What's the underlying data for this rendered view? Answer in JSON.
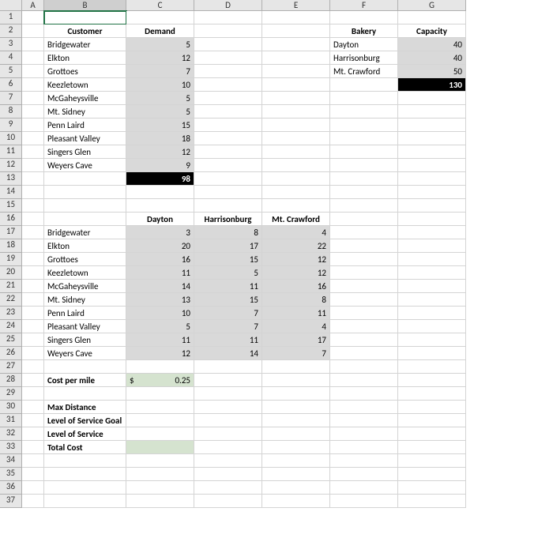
{
  "columns": [
    "",
    "A",
    "B",
    "C",
    "D",
    "E",
    "F",
    "G"
  ],
  "row_numbers": [
    1,
    2,
    3,
    4,
    5,
    6,
    7,
    8,
    9,
    10,
    11,
    12,
    13,
    14,
    15,
    16,
    17,
    18,
    19,
    20,
    21,
    22,
    23,
    24,
    25,
    26,
    27,
    28,
    29,
    30,
    31,
    32,
    33,
    34,
    35,
    36,
    37
  ],
  "headers": {
    "customer": "Customer",
    "demand": "Demand",
    "bakery": "Bakery",
    "capacity": "Capacity"
  },
  "customers": [
    {
      "name": "Bridgewater",
      "demand": 5
    },
    {
      "name": "Elkton",
      "demand": 12
    },
    {
      "name": "Grottoes",
      "demand": 7
    },
    {
      "name": "Keezletown",
      "demand": 10
    },
    {
      "name": "McGaheysville",
      "demand": 5
    },
    {
      "name": "Mt. Sidney",
      "demand": 5
    },
    {
      "name": "Penn Laird",
      "demand": 15
    },
    {
      "name": "Pleasant Valley",
      "demand": 18
    },
    {
      "name": "Singers Glen",
      "demand": 12
    },
    {
      "name": "Weyers Cave",
      "demand": 9
    }
  ],
  "demand_total": 98,
  "bakeries": [
    {
      "name": "Dayton",
      "capacity": 40
    },
    {
      "name": "Harrisonburg",
      "capacity": 40
    },
    {
      "name": "Mt. Crawford",
      "capacity": 50
    }
  ],
  "capacity_total": 130,
  "distance_cols": [
    "Dayton",
    "Harrisonburg",
    "Mt. Crawford"
  ],
  "distance_rows": [
    {
      "name": "Bridgewater",
      "d": [
        3,
        8,
        4
      ]
    },
    {
      "name": "Elkton",
      "d": [
        20,
        17,
        22
      ]
    },
    {
      "name": "Grottoes",
      "d": [
        16,
        15,
        12
      ]
    },
    {
      "name": "Keezletown",
      "d": [
        11,
        5,
        12
      ]
    },
    {
      "name": "McGaheysville",
      "d": [
        14,
        11,
        16
      ]
    },
    {
      "name": "Mt. Sidney",
      "d": [
        13,
        15,
        8
      ]
    },
    {
      "name": "Penn Laird",
      "d": [
        10,
        7,
        11
      ]
    },
    {
      "name": "Pleasant Valley",
      "d": [
        5,
        7,
        4
      ]
    },
    {
      "name": "Singers Glen",
      "d": [
        11,
        11,
        17
      ]
    },
    {
      "name": "Weyers Cave",
      "d": [
        12,
        14,
        7
      ]
    }
  ],
  "labels": {
    "cost_per_mile": "Cost per mile",
    "cost_per_mile_val_prefix": "$",
    "cost_per_mile_val": "0.25",
    "max_distance": "Max Distance",
    "level_of_service_goal": "Level of Service Goal",
    "level_of_service": "Level of Service",
    "total_cost": "Total Cost"
  },
  "chart_data": {
    "type": "table",
    "title": "Transportation problem data",
    "tables": [
      {
        "name": "customer_demand",
        "columns": [
          "Customer",
          "Demand"
        ],
        "rows": [
          [
            "Bridgewater",
            5
          ],
          [
            "Elkton",
            12
          ],
          [
            "Grottoes",
            7
          ],
          [
            "Keezletown",
            10
          ],
          [
            "McGaheysville",
            5
          ],
          [
            "Mt. Sidney",
            5
          ],
          [
            "Penn Laird",
            15
          ],
          [
            "Pleasant Valley",
            18
          ],
          [
            "Singers Glen",
            12
          ],
          [
            "Weyers Cave",
            9
          ]
        ],
        "total": 98
      },
      {
        "name": "bakery_capacity",
        "columns": [
          "Bakery",
          "Capacity"
        ],
        "rows": [
          [
            "Dayton",
            40
          ],
          [
            "Harrisonburg",
            40
          ],
          [
            "Mt. Crawford",
            50
          ]
        ],
        "total": 130
      },
      {
        "name": "distance_matrix",
        "columns": [
          "Customer",
          "Dayton",
          "Harrisonburg",
          "Mt. Crawford"
        ],
        "rows": [
          [
            "Bridgewater",
            3,
            8,
            4
          ],
          [
            "Elkton",
            20,
            17,
            22
          ],
          [
            "Grottoes",
            16,
            15,
            12
          ],
          [
            "Keezletown",
            11,
            5,
            12
          ],
          [
            "McGaheysville",
            14,
            11,
            16
          ],
          [
            "Mt. Sidney",
            13,
            15,
            8
          ],
          [
            "Penn Laird",
            10,
            7,
            11
          ],
          [
            "Pleasant Valley",
            5,
            7,
            4
          ],
          [
            "Singers Glen",
            11,
            11,
            17
          ],
          [
            "Weyers Cave",
            12,
            14,
            7
          ]
        ]
      },
      {
        "name": "parameters",
        "rows": [
          [
            "Cost per mile",
            "$ 0.25"
          ],
          [
            "Max Distance",
            ""
          ],
          [
            "Level of Service Goal",
            ""
          ],
          [
            "Level of Service",
            ""
          ],
          [
            "Total Cost",
            ""
          ]
        ]
      }
    ]
  }
}
